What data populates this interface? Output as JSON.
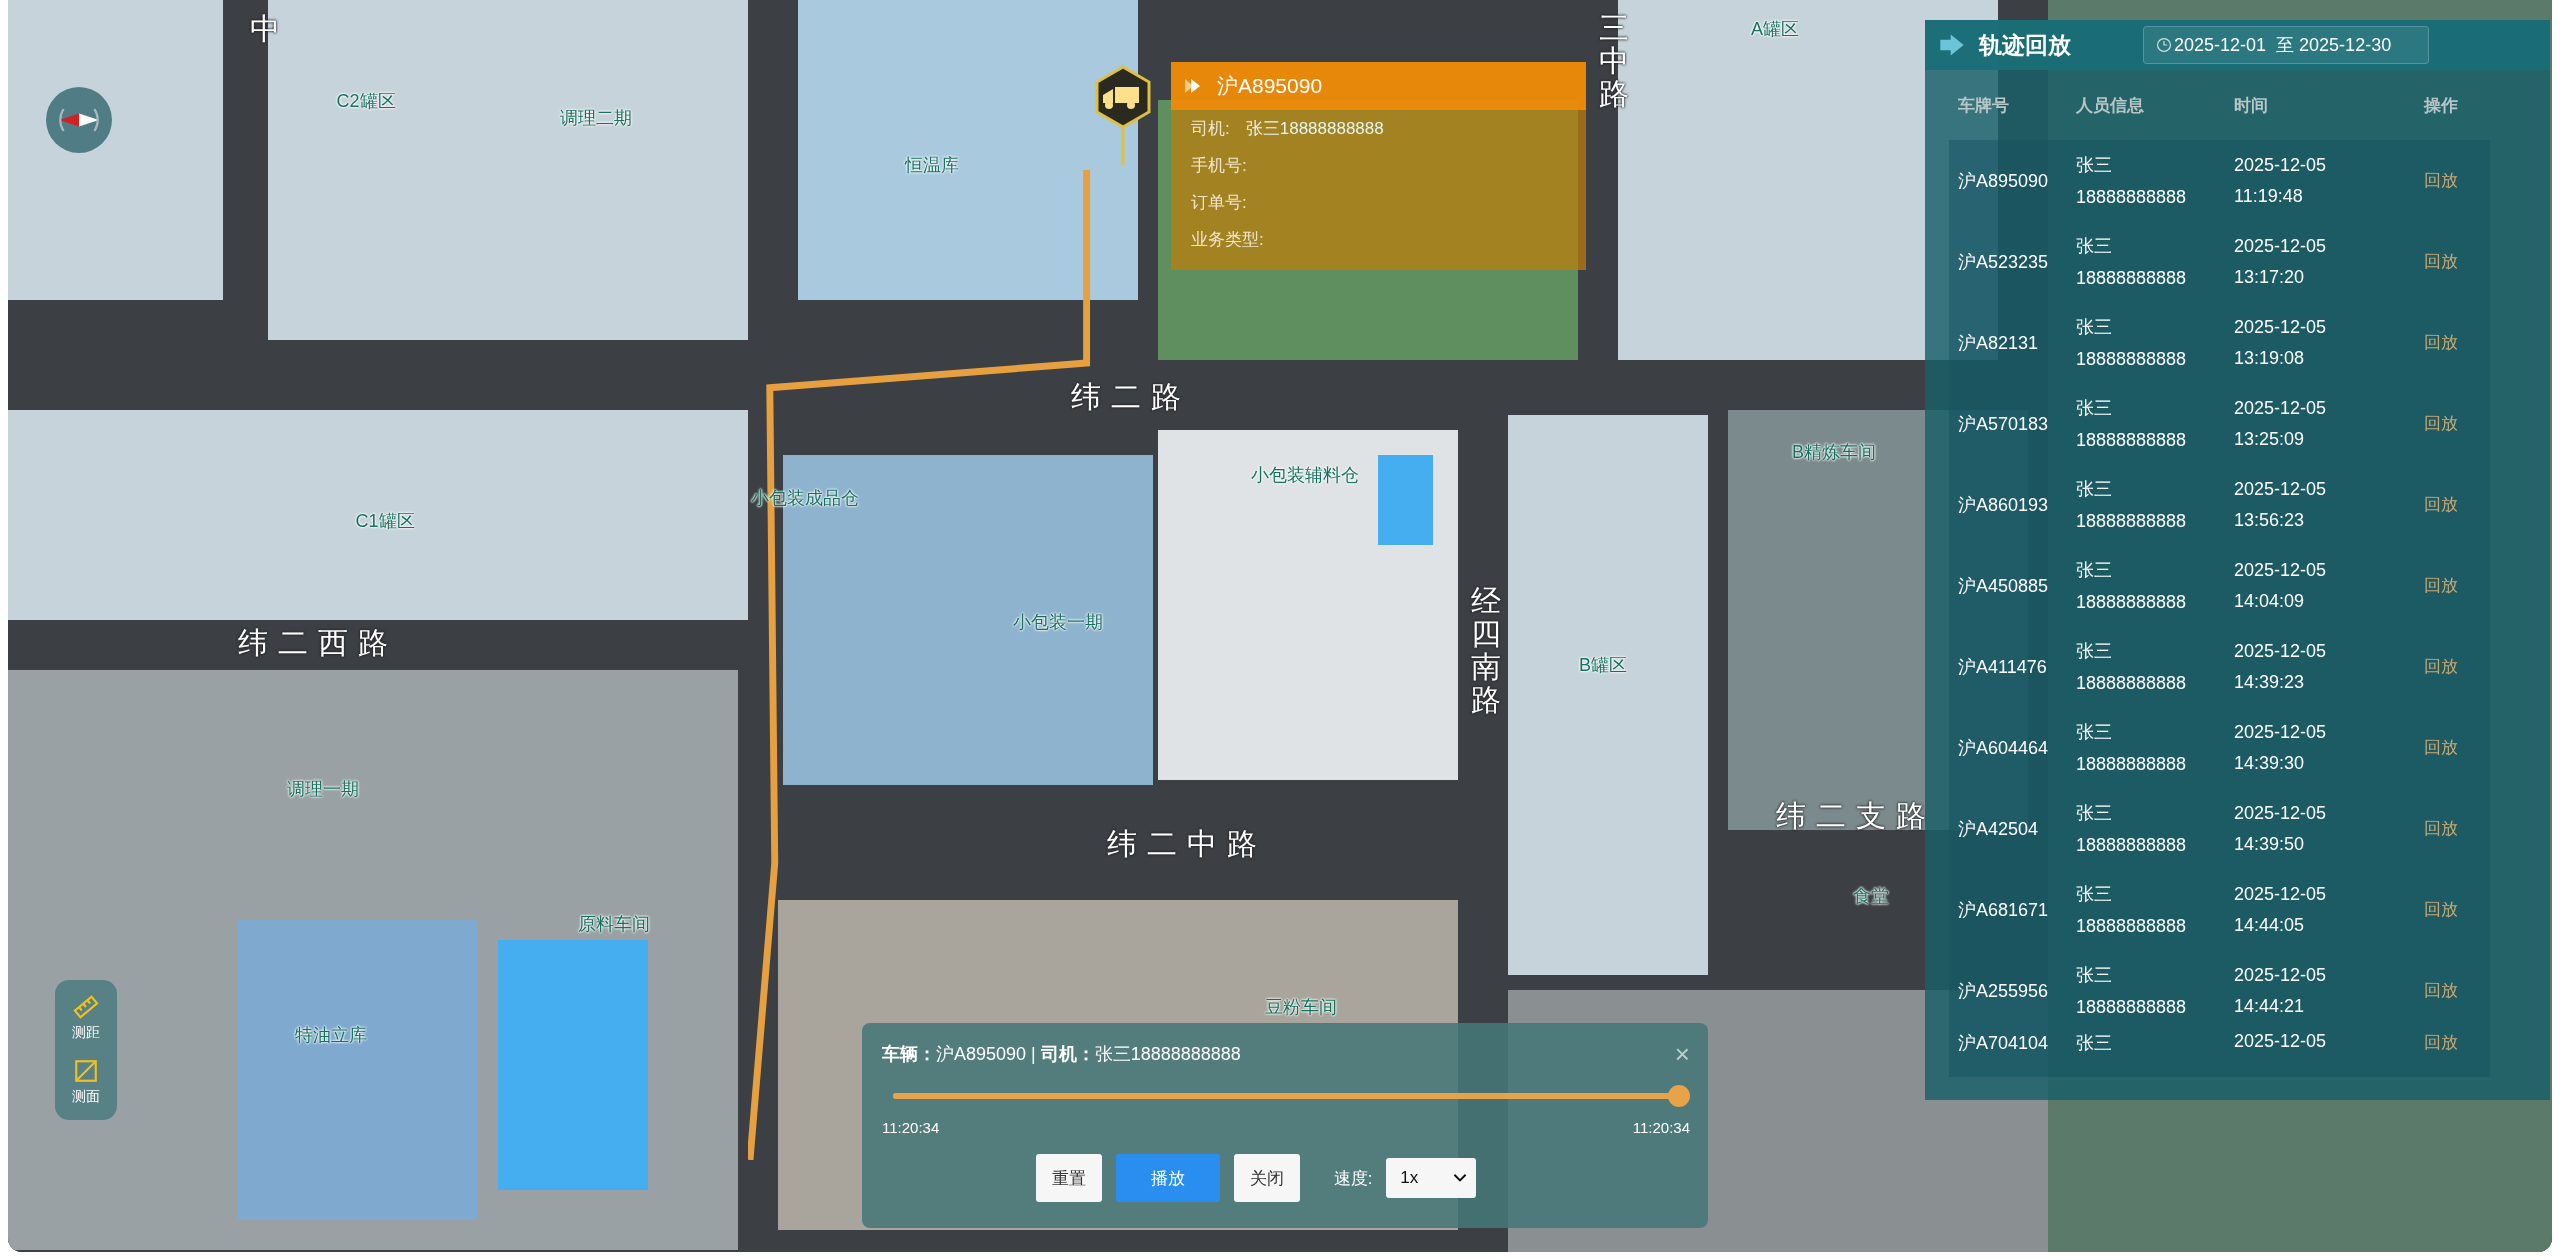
{
  "map": {
    "labels": [
      {
        "kind": "road",
        "text": "中"
      },
      {
        "kind": "road-vertical",
        "text": "三中路"
      },
      {
        "kind": "area",
        "text": "A罐区"
      },
      {
        "kind": "area",
        "text": "C2罐区"
      },
      {
        "kind": "area",
        "text": "调理二期"
      },
      {
        "kind": "area",
        "text": "恒温库"
      },
      {
        "kind": "area",
        "text": "小包装成品仓"
      },
      {
        "kind": "area",
        "text": "小包装辅料仓"
      },
      {
        "kind": "area",
        "text": "B精炼车间"
      },
      {
        "kind": "area",
        "text": "C1罐区"
      },
      {
        "kind": "area",
        "text": "小包装一期"
      },
      {
        "kind": "area",
        "text": "B罐区"
      },
      {
        "kind": "area",
        "text": "调理一期"
      },
      {
        "kind": "area",
        "text": "原料车间"
      },
      {
        "kind": "area",
        "text": "豆粉车间"
      },
      {
        "kind": "area",
        "text": "特油立库"
      },
      {
        "kind": "area",
        "text": "食堂"
      },
      {
        "kind": "road",
        "text": "纬二路"
      },
      {
        "kind": "road",
        "text": "纬二西路"
      },
      {
        "kind": "road",
        "text": "纬二中路"
      },
      {
        "kind": "road",
        "text": "纬二支路"
      },
      {
        "kind": "road-vertical",
        "text": "经四南路"
      }
    ]
  },
  "tools": [
    {
      "kind": "ruler",
      "label": "测距"
    },
    {
      "kind": "area",
      "label": "测面"
    }
  ],
  "popup": {
    "plate": "沪A895090",
    "fields": [
      {
        "label": "司机:",
        "value": "张三18888888888"
      },
      {
        "label": "手机号:"
      },
      {
        "label": "订单号:"
      },
      {
        "label": "业务类型:"
      }
    ]
  },
  "panel": {
    "title": "轨迹回放",
    "date_range": "2025-12-01  至 2025-12-30",
    "columns": [
      "车牌号",
      "人员信息",
      "时间",
      "操作"
    ],
    "rows": [
      {
        "plate": "沪A895090",
        "name": "张三",
        "phone": "18888888888",
        "date": "2025-12-05",
        "time": "11:19:48",
        "action": "回放"
      },
      {
        "plate": "沪A523235",
        "name": "张三",
        "phone": "18888888888",
        "date": "2025-12-05",
        "time": "13:17:20",
        "action": "回放"
      },
      {
        "plate": "沪A82131",
        "name": "张三",
        "phone": "18888888888",
        "date": "2025-12-05",
        "time": "13:19:08",
        "action": "回放"
      },
      {
        "plate": "沪A570183",
        "name": "张三",
        "phone": "18888888888",
        "date": "2025-12-05",
        "time": "13:25:09",
        "action": "回放"
      },
      {
        "plate": "沪A860193",
        "name": "张三",
        "phone": "18888888888",
        "date": "2025-12-05",
        "time": "13:56:23",
        "action": "回放"
      },
      {
        "plate": "沪A450885",
        "name": "张三",
        "phone": "18888888888",
        "date": "2025-12-05",
        "time": "14:04:09",
        "action": "回放"
      },
      {
        "plate": "沪A411476",
        "name": "张三",
        "phone": "18888888888",
        "date": "2025-12-05",
        "time": "14:39:23",
        "action": "回放"
      },
      {
        "plate": "沪A604464",
        "name": "张三",
        "phone": "18888888888",
        "date": "2025-12-05",
        "time": "14:39:30",
        "action": "回放"
      },
      {
        "plate": "沪A42504",
        "name": "张三",
        "phone": "18888888888",
        "date": "2025-12-05",
        "time": "14:39:50",
        "action": "回放"
      },
      {
        "plate": "沪A681671",
        "name": "张三",
        "phone": "18888888888",
        "date": "2025-12-05",
        "time": "14:44:05",
        "action": "回放"
      },
      {
        "plate": "沪A255956",
        "name": "张三",
        "phone": "18888888888",
        "date": "2025-12-05",
        "time": "14:44:21",
        "action": "回放"
      },
      {
        "plate": "沪A704104",
        "name": "张三",
        "date": "2025-12-05",
        "action": "回放"
      }
    ]
  },
  "player": {
    "info": "**车辆：**沪A895090 | **司机：**张三18888888888",
    "close": "×",
    "level": 1,
    "start_time": "11:20:34",
    "end_time": "11:20:34",
    "buttons": [
      {
        "kind": "default",
        "label": "重置"
      },
      {
        "kind": "primary",
        "label": "播放"
      },
      {
        "kind": "default",
        "label": "关闭"
      }
    ],
    "speed_label": "速度:",
    "speed": "1x"
  }
}
